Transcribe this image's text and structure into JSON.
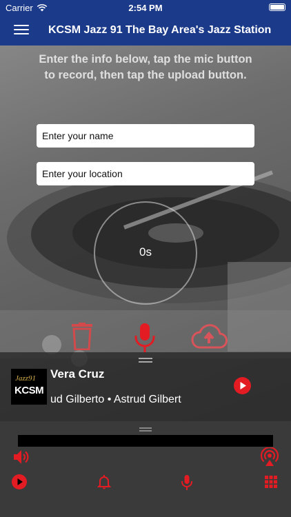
{
  "status_bar": {
    "carrier": "Carrier",
    "time": "2:54 PM"
  },
  "nav": {
    "title": "KCSM Jazz 91  The Bay Area's Jazz Station"
  },
  "form": {
    "instructions": "Enter the info below, tap the mic button to record, then tap the upload button.",
    "name_placeholder": "Enter your name",
    "location_placeholder": "Enter your location",
    "timer": "0s"
  },
  "now_playing": {
    "logo_top": "Jazz91",
    "logo_main": "KCSM",
    "song": "Vera Cruz",
    "artist": "ud Gilberto • Astrud Gilbert"
  },
  "icons": {
    "menu": "hamburger-icon",
    "trash": "trash-icon",
    "mic": "microphone-icon",
    "upload": "cloud-upload-icon",
    "play": "play-icon",
    "volume": "volume-icon",
    "broadcast": "broadcast-icon",
    "bell": "bell-icon",
    "grid": "grid-icon"
  },
  "colors": {
    "nav": "#1c3a8a",
    "accent": "#e31b23"
  }
}
